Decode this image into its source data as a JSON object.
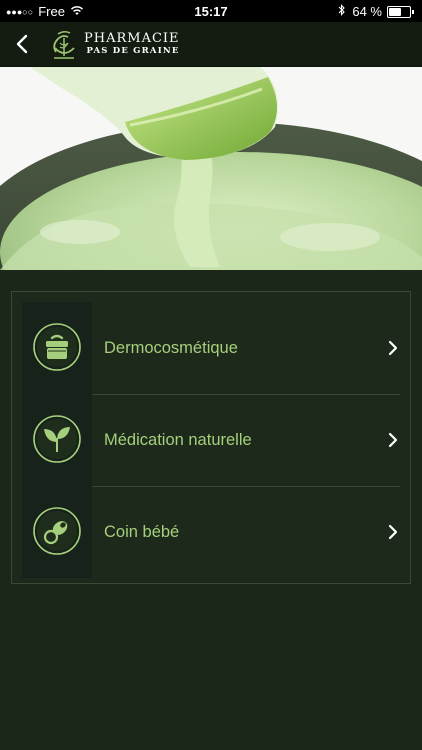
{
  "status_bar": {
    "signal": "●●●○○",
    "carrier": "Free",
    "time": "15:17",
    "battery": "64 %",
    "battery_level": 0.64
  },
  "nav": {
    "back_icon": "chevron-left-icon",
    "logo_line1": "PHARMACIE",
    "logo_line2": "PAS DE GRAINE"
  },
  "menu": {
    "items": [
      {
        "label": "Dermocosmétique",
        "icon": "cream-jar-icon"
      },
      {
        "label": "Médication naturelle",
        "icon": "leaves-icon"
      },
      {
        "label": "Coin bébé",
        "icon": "pacifier-icon"
      }
    ]
  },
  "colors": {
    "accent": "#a5cf7c",
    "background": "#1b2718",
    "nav": "#141c12"
  }
}
